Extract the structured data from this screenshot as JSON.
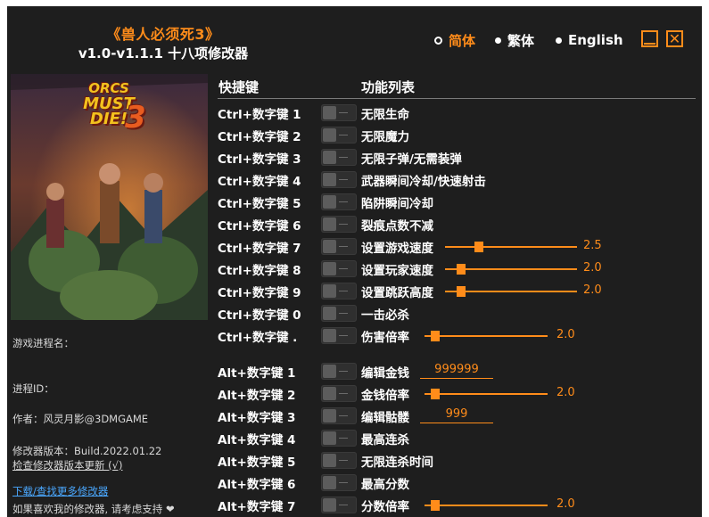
{
  "header": {
    "title": "《兽人必须死3》",
    "subtitle": "v1.0-v1.1.1 十八项修改器",
    "languages": [
      {
        "label": "简体",
        "active": true
      },
      {
        "label": "繁体",
        "active": false
      },
      {
        "label": "English",
        "active": false
      }
    ],
    "close_glyph": "✕"
  },
  "cover": {
    "logo_lines": [
      "ORCS",
      "MUST",
      "DIE!",
      "3"
    ]
  },
  "info": {
    "process_name": "游戏进程名：",
    "process_id": "进程ID：",
    "author": "作者：风灵月影@3DMGAME",
    "version": "修改器版本：Build.2022.01.22",
    "check_update": "检查修改器版本更新 (√)",
    "download_link": "下载/查找更多修改器",
    "support": "如果喜欢我的修改器, 请考虑支持 ❤"
  },
  "table": {
    "col_hotkey": "快捷键",
    "col_feature": "功能列表",
    "rows": [
      {
        "hotkey": "Ctrl+数字键 1",
        "feature": "无限生命"
      },
      {
        "hotkey": "Ctrl+数字键 2",
        "feature": "无限魔力"
      },
      {
        "hotkey": "Ctrl+数字键 3",
        "feature": "无限子弹/无需装弹"
      },
      {
        "hotkey": "Ctrl+数字键 4",
        "feature": "武器瞬间冷却/快速射击"
      },
      {
        "hotkey": "Ctrl+数字键 5",
        "feature": "陷阱瞬间冷却"
      },
      {
        "hotkey": "Ctrl+数字键 6",
        "feature": "裂痕点数不减"
      },
      {
        "hotkey": "Ctrl+数字键 7",
        "feature": "设置游戏速度",
        "slider": {
          "value": "2.5",
          "fraction": 0.26
        }
      },
      {
        "hotkey": "Ctrl+数字键 8",
        "feature": "设置玩家速度",
        "slider": {
          "value": "2.0",
          "fraction": 0.12
        }
      },
      {
        "hotkey": "Ctrl+数字键 9",
        "feature": "设置跳跃高度",
        "slider": {
          "value": "2.0",
          "fraction": 0.12
        }
      },
      {
        "hotkey": "Ctrl+数字键 0",
        "feature": "一击必杀"
      },
      {
        "hotkey": "Ctrl+数字键 .",
        "feature": "伤害倍率",
        "slider": {
          "value": "2.0",
          "fraction": 0.09
        }
      },
      {
        "hotkey": "Alt+数字键 1",
        "feature": "编辑金钱",
        "input": "999999"
      },
      {
        "hotkey": "Alt+数字键 2",
        "feature": "金钱倍率",
        "slider": {
          "value": "2.0",
          "fraction": 0.09
        }
      },
      {
        "hotkey": "Alt+数字键 3",
        "feature": "编辑骷髅",
        "input": "999"
      },
      {
        "hotkey": "Alt+数字键 4",
        "feature": "最高连杀"
      },
      {
        "hotkey": "Alt+数字键 5",
        "feature": "无限连杀时间"
      },
      {
        "hotkey": "Alt+数字键 6",
        "feature": "最高分数"
      },
      {
        "hotkey": "Alt+数字键 7",
        "feature": "分数倍率",
        "slider": {
          "value": "2.0",
          "fraction": 0.09
        }
      }
    ]
  },
  "colors": {
    "accent": "#ff8c1a",
    "background": "#1e1e1e",
    "text": "#ffffff",
    "link": "#4aa8ff"
  }
}
